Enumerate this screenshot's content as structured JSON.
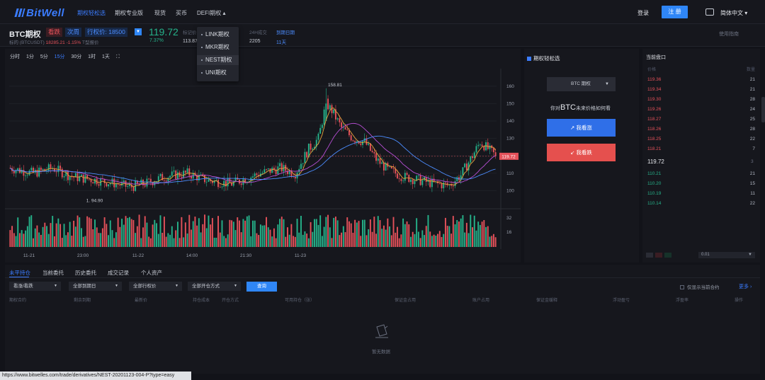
{
  "nav": {
    "logo": "BitWell",
    "links": [
      "期权轻松选",
      "期权专业版",
      "现货",
      "买币",
      "DEFI期权 ▴"
    ],
    "login": "登录",
    "register": "注 册",
    "language": "简体中文 ▾"
  },
  "defi_menu": [
    "LINK期权",
    "MKR期权",
    "NEST期权",
    "UNI期权"
  ],
  "ticker": {
    "symbol": "BTC期权",
    "direction": "看跌",
    "expiry": "次周",
    "strike": "行权价: 18500",
    "underlying_label": "标的 (BTCUSDT)",
    "underlying_value": "18285.21 -1.15%",
    "underlying_extra": "T型报价",
    "price": "119.72",
    "change": "7.37%",
    "stats": [
      {
        "label": "标记价",
        "value": "113.87"
      },
      {
        "label": "",
        "value": "18"
      },
      {
        "label": "24H成交",
        "value": "2205"
      },
      {
        "label": "到期日期",
        "value": "11天"
      }
    ],
    "guide": "使用指南"
  },
  "intervals": [
    "分时",
    "1分",
    "5分",
    "15分",
    "30分",
    "1时",
    "1天",
    "⛶"
  ],
  "active_interval": 3,
  "chart_data": {
    "type": "candlestick",
    "price_axis": [
      160,
      150,
      140,
      130,
      120,
      110,
      100
    ],
    "volume_axis": [
      32,
      16
    ],
    "time_labels": [
      "11-21",
      "23:00",
      "11-22",
      "14:00",
      "21:30",
      "11-23"
    ],
    "last_price": "119.72",
    "high_label": "158.81",
    "low_label": "94.90",
    "colors": {
      "up": "#25b28a",
      "down": "#e4515a",
      "ma1": "#e8a33d",
      "ma2": "#b84fd6",
      "ma3": "#4c8dff"
    }
  },
  "quick": {
    "title": "期权轻松选",
    "asset": "BTC 期权",
    "question_pre": "你对",
    "question_big": "BTC",
    "question_post": "未来价格如何看",
    "call": "↗ 我看涨",
    "put": "↙ 我看跌"
  },
  "book": {
    "title": "当前盘口",
    "hdr_left": "价格",
    "hdr_right": "数量",
    "asks": [
      {
        "p": "119.36",
        "q": "21"
      },
      {
        "p": "119.34",
        "q": "21"
      },
      {
        "p": "119.30",
        "q": "28"
      },
      {
        "p": "119.26",
        "q": "24"
      },
      {
        "p": "118.27",
        "q": "25"
      },
      {
        "p": "118.26",
        "q": "28"
      },
      {
        "p": "118.25",
        "q": "22"
      },
      {
        "p": "118.21",
        "q": "7"
      }
    ],
    "mid": "119.72",
    "mid_q": "3",
    "bids": [
      {
        "p": "110.21",
        "q": "21"
      },
      {
        "p": "110.20",
        "q": "15"
      },
      {
        "p": "110.19",
        "q": "11"
      },
      {
        "p": "110.14",
        "q": "22"
      }
    ],
    "depth": "0.01"
  },
  "bottom": {
    "tabs": [
      "未平持仓",
      "当前委托",
      "历史委托",
      "成交记录",
      "个人资产"
    ],
    "filters": [
      "看涨/看跌",
      "全部到期日",
      "全部行权价",
      "全部开仓方式"
    ],
    "query": "查询",
    "only_current": "仅显示当前合约",
    "more": "更多 ›",
    "columns": [
      "期权合约",
      "剩余到期",
      "最新价",
      "持仓成本",
      "开仓方式",
      "可用持仓（张）",
      "保证金占用",
      "账户占用",
      "保证金缓释",
      "浮动盈亏",
      "浮盈率",
      "操作"
    ],
    "empty": "暂无数据"
  },
  "statusbar": "https://www.bitwelles.com/trade/derivatives/NEST-20201123-004-P?type=easy"
}
